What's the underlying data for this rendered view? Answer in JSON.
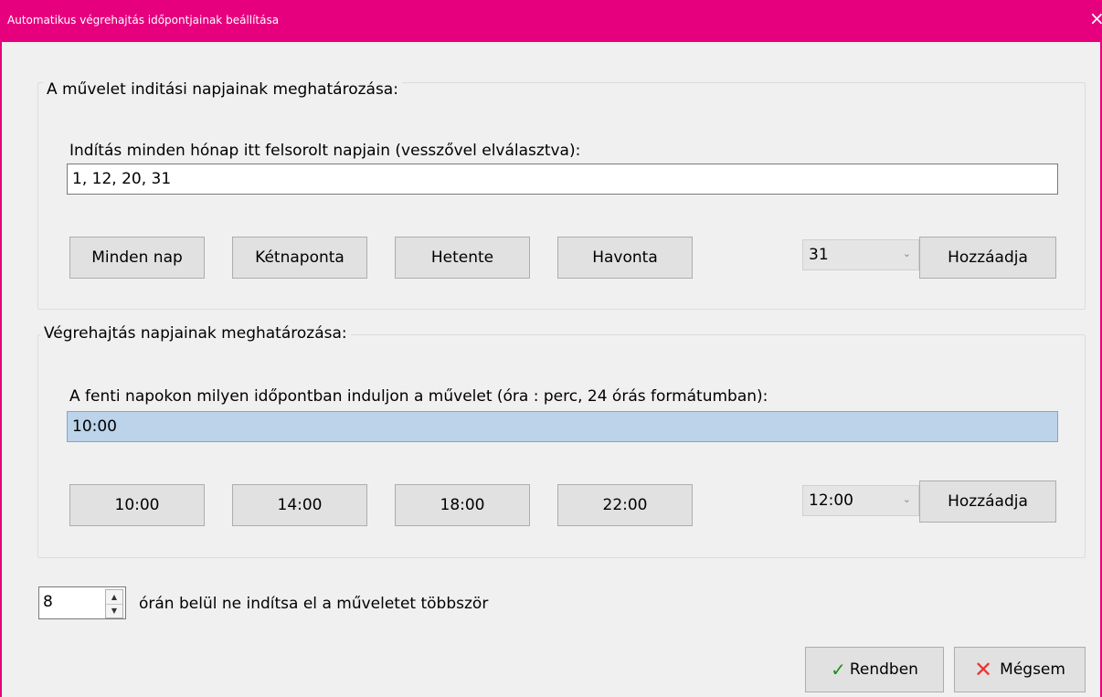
{
  "window": {
    "title": "Automatikus végrehajtás időpontjainak beállítása",
    "close_glyph": "×"
  },
  "days_group": {
    "legend": "A művelet inditási napjainak meghatározása:",
    "field_label": "Indítás minden hónap itt felsorolt napjain (vesszővel elválasztva):",
    "field_value": "1, 12, 20, 31",
    "preset_buttons": [
      "Minden nap",
      "Kétnaponta",
      "Hetente",
      "Havonta"
    ],
    "combo_value": "31",
    "add_button": "Hozzáadja"
  },
  "time_group": {
    "legend": "Végrehajtás napjainak meghatározása:",
    "field_label": "A fenti napokon milyen időpontban induljon a művelet (óra : perc, 24 órás formátumban):",
    "field_value": "10:00",
    "preset_buttons": [
      "10:00",
      "14:00",
      "18:00",
      "22:00"
    ],
    "combo_value": "12:00",
    "add_button": "Hozzáadja"
  },
  "repeat": {
    "spin_value": "8",
    "label": "órán belül ne indítsa el a műveletet többször"
  },
  "footer": {
    "ok_label": "Rendben",
    "cancel_label": "Mégsem",
    "ok_icon": "checkmark-icon",
    "cancel_icon": "x-icon"
  },
  "colors": {
    "title_bar": "#e6007e",
    "selected_field": "#bcd3ea"
  }
}
